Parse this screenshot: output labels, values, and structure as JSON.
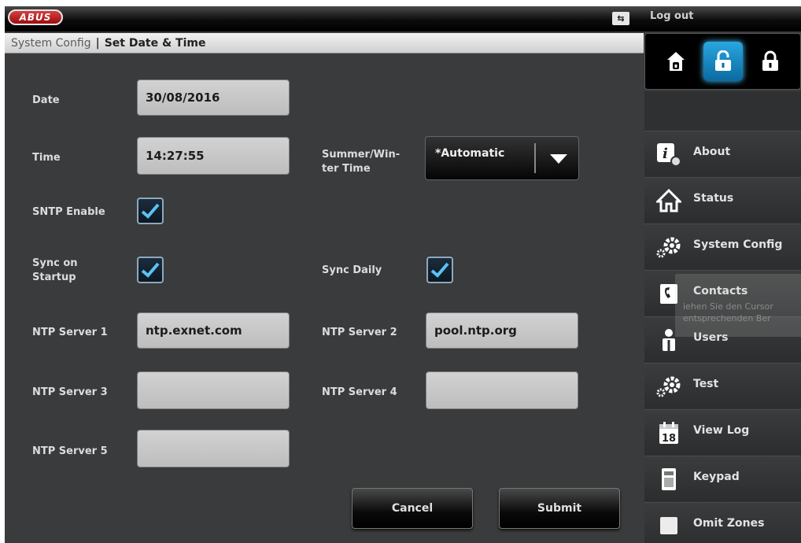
{
  "header": {
    "logo_text": "ABUS",
    "user_switch_icon": "user-switch-icon",
    "logout_label": "Log out"
  },
  "breadcrumb": {
    "parent": "System Config",
    "separator": "|",
    "current": "Set Date & Time"
  },
  "modes": [
    {
      "name": "home-icon",
      "active": false
    },
    {
      "name": "unlock-icon",
      "active": true
    },
    {
      "name": "lock-icon",
      "active": false
    }
  ],
  "form": {
    "date_label": "Date",
    "date_value": "30/08/2016",
    "time_label": "Time",
    "time_value": "14:27:55",
    "summer_label_line1": "Summer/Win-",
    "summer_label_line2": "ter Time",
    "summer_value": "*Automatic",
    "sntp_label": "SNTP Enable",
    "sntp_checked": true,
    "sync_startup_label_line1": "Sync on",
    "sync_startup_label_line2": "Startup",
    "sync_startup_checked": true,
    "sync_daily_label": "Sync Daily",
    "sync_daily_checked": true,
    "ntp1_label": "NTP Server 1",
    "ntp1_value": "ntp.exnet.com",
    "ntp2_label": "NTP Server 2",
    "ntp2_value": "pool.ntp.org",
    "ntp3_label": "NTP Server 3",
    "ntp3_value": "",
    "ntp4_label": "NTP Server 4",
    "ntp4_value": "",
    "ntp5_label": "NTP Server 5",
    "ntp5_value": ""
  },
  "buttons": {
    "cancel": "Cancel",
    "submit": "Submit"
  },
  "sidebar": {
    "items": [
      {
        "label": "About",
        "icon": "info-gear-icon"
      },
      {
        "label": "Status",
        "icon": "house-icon"
      },
      {
        "label": "System Config",
        "icon": "gears-icon"
      },
      {
        "label": "Contacts",
        "icon": "phone-book-icon"
      },
      {
        "label": "Users",
        "icon": "user-icon"
      },
      {
        "label": "Test",
        "icon": "gears-icon"
      },
      {
        "label": "View Log",
        "icon": "calendar-icon"
      },
      {
        "label": "Keypad",
        "icon": "keypad-icon"
      },
      {
        "label": "Omit Zones",
        "icon": "omit-zones-icon"
      }
    ],
    "calendar_day": "18"
  },
  "tooltip": {
    "line1": "iehen Sie den Cursor",
    "line2": "entsprechenden Ber"
  }
}
